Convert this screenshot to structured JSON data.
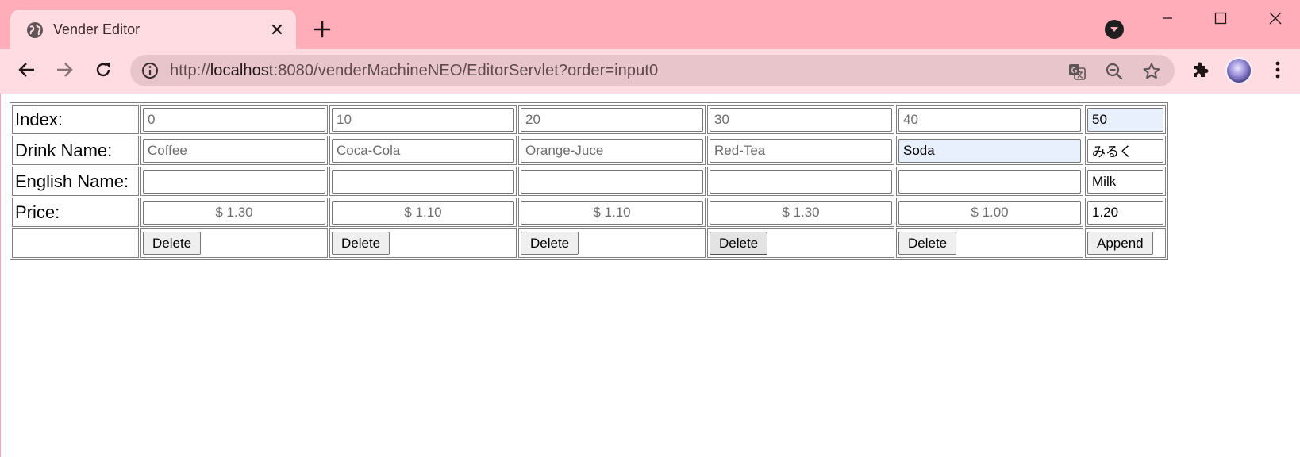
{
  "browser": {
    "tab_title": "Vender Editor",
    "url_prefix": "http://",
    "url_host": "localhost",
    "url_rest": ":8080/venderMachineNEO/EditorServlet?order=input0",
    "theme_color": "#ffadb8"
  },
  "editor": {
    "labels": {
      "index": "Index:",
      "drink_name": "Drink Name:",
      "english_name": "English Name:",
      "price": "Price:"
    },
    "columns": [
      {
        "index": "0",
        "drink_name": "Coffee",
        "english_name": "",
        "price": "$ 1.30",
        "button": "Delete"
      },
      {
        "index": "10",
        "drink_name": "Coca-Cola",
        "english_name": "",
        "price": "$ 1.10",
        "button": "Delete"
      },
      {
        "index": "20",
        "drink_name": "Orange-Juce",
        "english_name": "",
        "price": "$ 1.10",
        "button": "Delete"
      },
      {
        "index": "30",
        "drink_name": "Red-Tea",
        "english_name": "",
        "price": "$ 1.30",
        "button": "Delete"
      },
      {
        "index": "40",
        "drink_name": "Soda",
        "english_name": "",
        "price": "$ 1.00",
        "button": "Delete"
      }
    ],
    "new_entry": {
      "index": "50",
      "drink_name": "みるく",
      "english_name": "Milk",
      "price": "1.20",
      "button": "Append"
    }
  }
}
